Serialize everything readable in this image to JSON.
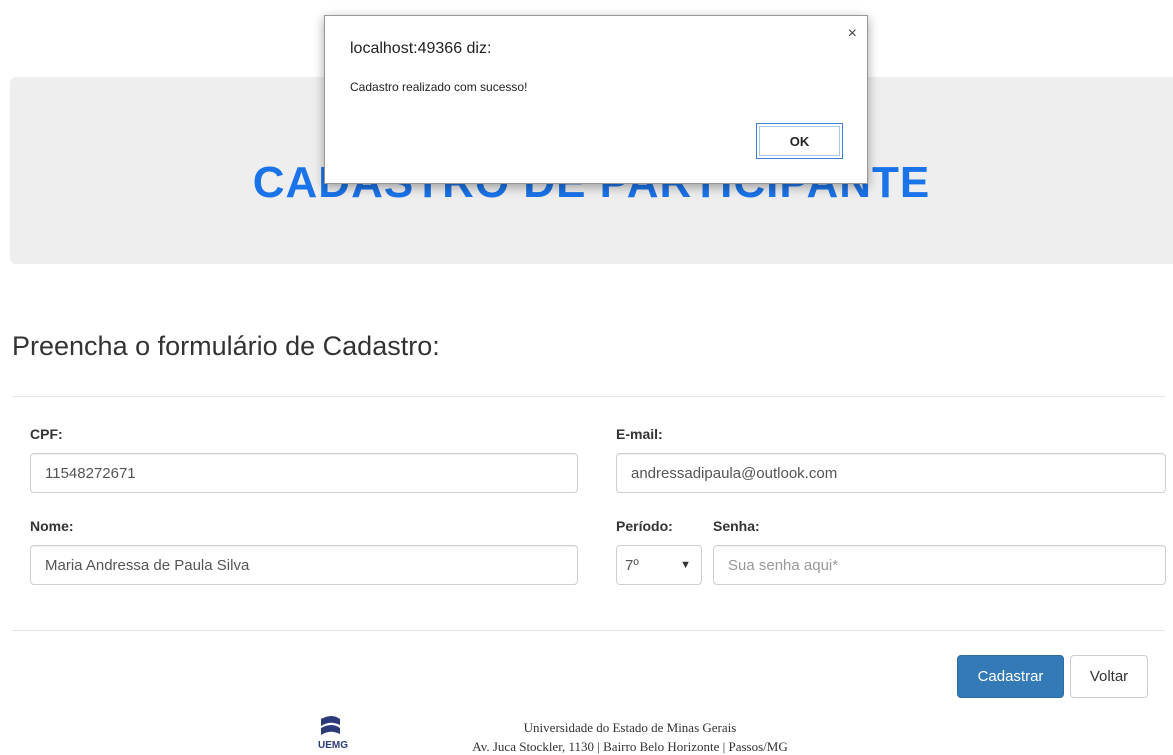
{
  "jumbotron": {
    "title": "CADASTRO DE PARTICIPANTE"
  },
  "form": {
    "heading": "Preencha o formulário de Cadastro:",
    "cpf": {
      "label": "CPF:",
      "value": "11548272671"
    },
    "email": {
      "label": "E-mail:",
      "value": "andressadipaula@outlook.com"
    },
    "nome": {
      "label": "Nome:",
      "value": "Maria Andressa de Paula Silva"
    },
    "periodo": {
      "label": "Período:",
      "value": "7º"
    },
    "senha": {
      "label": "Senha:",
      "placeholder": "Sua senha aqui*"
    }
  },
  "buttons": {
    "submit": "Cadastrar",
    "back": "Voltar"
  },
  "footer": {
    "logo_text": "UEMG",
    "line1": "Universidade do Estado de Minas Gerais",
    "line2": "Av. Juca Stockler, 1130 | Bairro Belo Horizonte | Passos/MG"
  },
  "dialog": {
    "title": "localhost:49366 diz:",
    "message": "Cadastro realizado com sucesso!",
    "ok_label": "OK",
    "close_glyph": "×"
  },
  "colors": {
    "primary": "#337ab7",
    "title_blue": "#1a73e8",
    "jumbotron_bg": "#eeeeee"
  }
}
